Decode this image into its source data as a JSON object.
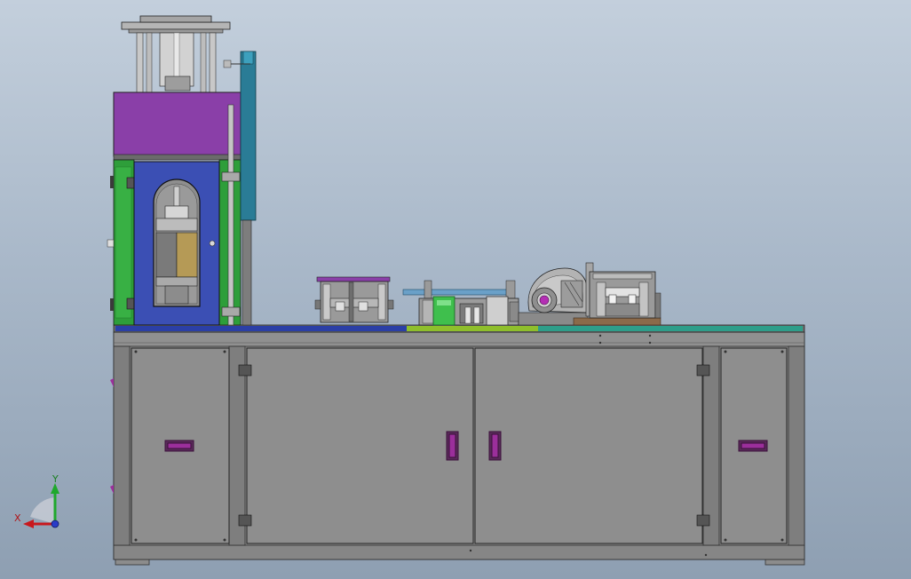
{
  "triad": {
    "x_label": "X",
    "y_label": "Y"
  },
  "colors": {
    "frame": "#8a8a8a",
    "frame_dark": "#5f5f5f",
    "press_top": "#8a3fa8",
    "press_side": "#2e9e3a",
    "press_door": "#3b4fb4",
    "teal_column": "#2a7c96",
    "handle": "#9b2f9b",
    "strip_blue": "#2b3fa6",
    "strip_green": "#8fbf2c",
    "strip_teal": "#2e9e8a"
  }
}
